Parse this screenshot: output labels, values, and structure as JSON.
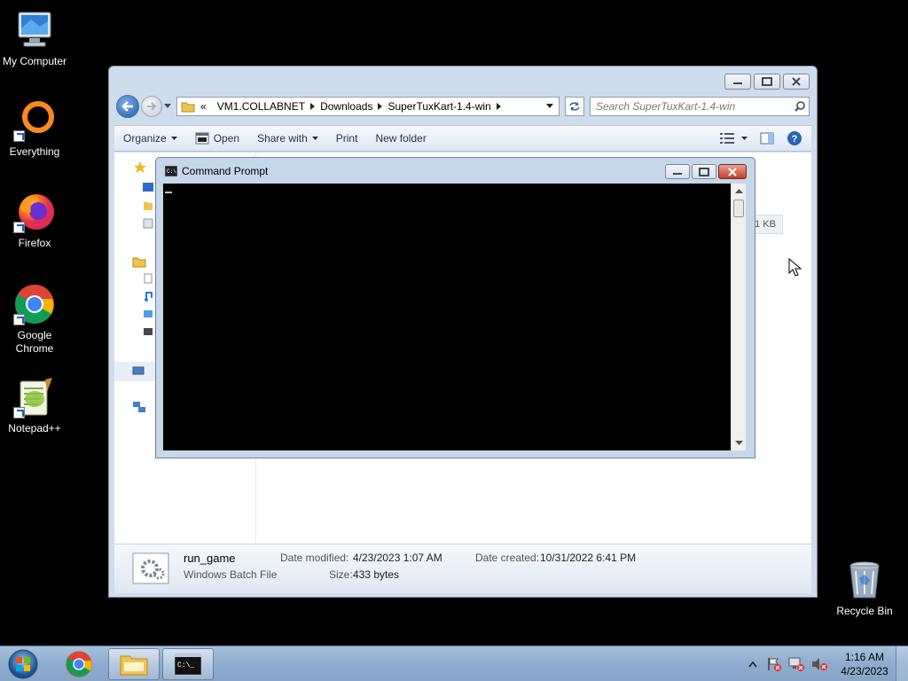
{
  "desktop": {
    "icons": [
      {
        "label": "My Computer"
      },
      {
        "label": "Everything"
      },
      {
        "label": "Firefox"
      },
      {
        "label": "Google Chrome"
      },
      {
        "label": "Notepad++"
      },
      {
        "label": "Recycle Bin"
      }
    ]
  },
  "explorer": {
    "breadcrumb_prefix": "«",
    "breadcrumb": [
      "VM1.COLLABNET",
      "Downloads",
      "SuperTuxKart-1.4-win"
    ],
    "search_placeholder": "Search SuperTuxKart-1.4-win",
    "toolbar": {
      "organize": "Organize",
      "open": "Open",
      "share_with": "Share with",
      "print": "Print",
      "new_folder": "New folder"
    },
    "partial_size_label": "1 KB",
    "details": {
      "file_name": "run_game",
      "file_type": "Windows Batch File",
      "date_modified_label": "Date modified:",
      "date_modified": "4/23/2023 1:07 AM",
      "date_created_label": "Date created:",
      "date_created": "10/31/2022 6:41 PM",
      "size_label": "Size:",
      "size": "433 bytes"
    }
  },
  "cmd": {
    "title": "Command Prompt"
  },
  "taskbar": {
    "time": "1:16 AM",
    "date": "4/23/2023"
  },
  "colors": {
    "desktop_bg": "#000000",
    "window_frame": "#cfdcec",
    "close_red": "#c1402b",
    "taskbar": "#8eaccd"
  }
}
